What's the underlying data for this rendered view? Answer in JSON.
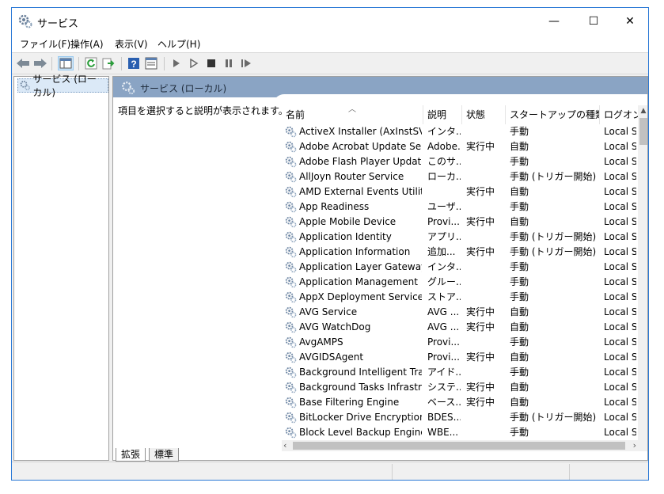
{
  "window": {
    "title": "サービス"
  },
  "window_controls": {
    "minimize": "—",
    "maximize": "☐",
    "close": "✕"
  },
  "menu": [
    "ファイル(F)",
    "操作(A)",
    "表示(V)",
    "ヘルプ(H)"
  ],
  "tree": {
    "root": "サービス (ローカル)"
  },
  "pane": {
    "title": "サービス (ローカル)",
    "description": "項目を選択すると説明が表示されます。"
  },
  "columns": [
    "名前",
    "説明",
    "状態",
    "スタートアップの種類",
    "ログオン"
  ],
  "services": [
    {
      "name": "ActiveX Installer (AxInstSV)",
      "desc": "インタ...",
      "status": "",
      "startup": "手動",
      "logon": "Local S"
    },
    {
      "name": "Adobe Acrobat Update Serv...",
      "desc": "Adobe...",
      "status": "実行中",
      "startup": "自動",
      "logon": "Local S"
    },
    {
      "name": "Adobe Flash Player Update ...",
      "desc": "このサ...",
      "status": "",
      "startup": "手動",
      "logon": "Local S"
    },
    {
      "name": "AllJoyn Router Service",
      "desc": "ローカ...",
      "status": "",
      "startup": "手動 (トリガー開始)",
      "logon": "Local S"
    },
    {
      "name": "AMD External Events Utility",
      "desc": "",
      "status": "実行中",
      "startup": "自動",
      "logon": "Local S"
    },
    {
      "name": "App Readiness",
      "desc": "ユーザ...",
      "status": "",
      "startup": "手動",
      "logon": "Local S"
    },
    {
      "name": "Apple Mobile Device",
      "desc": "Provi...",
      "status": "実行中",
      "startup": "自動",
      "logon": "Local S"
    },
    {
      "name": "Application Identity",
      "desc": "アプリ...",
      "status": "",
      "startup": "手動 (トリガー開始)",
      "logon": "Local S"
    },
    {
      "name": "Application Information",
      "desc": "追加...",
      "status": "実行中",
      "startup": "手動 (トリガー開始)",
      "logon": "Local S"
    },
    {
      "name": "Application Layer Gateway ...",
      "desc": "インタ...",
      "status": "",
      "startup": "手動",
      "logon": "Local S"
    },
    {
      "name": "Application Management",
      "desc": "グルー...",
      "status": "",
      "startup": "手動",
      "logon": "Local S"
    },
    {
      "name": "AppX Deployment Service (...",
      "desc": "ストア...",
      "status": "",
      "startup": "手動",
      "logon": "Local S"
    },
    {
      "name": "AVG Service",
      "desc": "AVG ...",
      "status": "実行中",
      "startup": "自動",
      "logon": "Local S"
    },
    {
      "name": "AVG WatchDog",
      "desc": "AVG ...",
      "status": "実行中",
      "startup": "自動",
      "logon": "Local S"
    },
    {
      "name": "AvgAMPS",
      "desc": "Provi...",
      "status": "",
      "startup": "手動",
      "logon": "Local S"
    },
    {
      "name": "AVGIDSAgent",
      "desc": "Provi...",
      "status": "実行中",
      "startup": "自動",
      "logon": "Local S"
    },
    {
      "name": "Background Intelligent Tran...",
      "desc": "アイド...",
      "status": "",
      "startup": "手動",
      "logon": "Local S"
    },
    {
      "name": "Background Tasks Infrastruc...",
      "desc": "システ...",
      "status": "実行中",
      "startup": "自動",
      "logon": "Local S"
    },
    {
      "name": "Base Filtering Engine",
      "desc": "ベース...",
      "status": "実行中",
      "startup": "自動",
      "logon": "Local S"
    },
    {
      "name": "BitLocker Drive Encryption ...",
      "desc": "BDES...",
      "status": "",
      "startup": "手動 (トリガー開始)",
      "logon": "Local S"
    },
    {
      "name": "Block Level Backup Engine ...",
      "desc": "WBE...",
      "status": "",
      "startup": "手動",
      "logon": "Local S"
    }
  ],
  "tabs": [
    "拡張",
    "標準"
  ],
  "icons": [
    "gear-icon",
    "back-icon",
    "forward-icon",
    "show-tree-icon",
    "refresh-icon",
    "export-icon",
    "help-icon",
    "properties-icon",
    "play-icon",
    "play-alt-icon",
    "stop-icon",
    "pause-icon",
    "restart-icon"
  ],
  "colors": {
    "window_border": "#2b79d6",
    "pane_header": "#8aa4c4",
    "selection": "#dbe9f7"
  }
}
